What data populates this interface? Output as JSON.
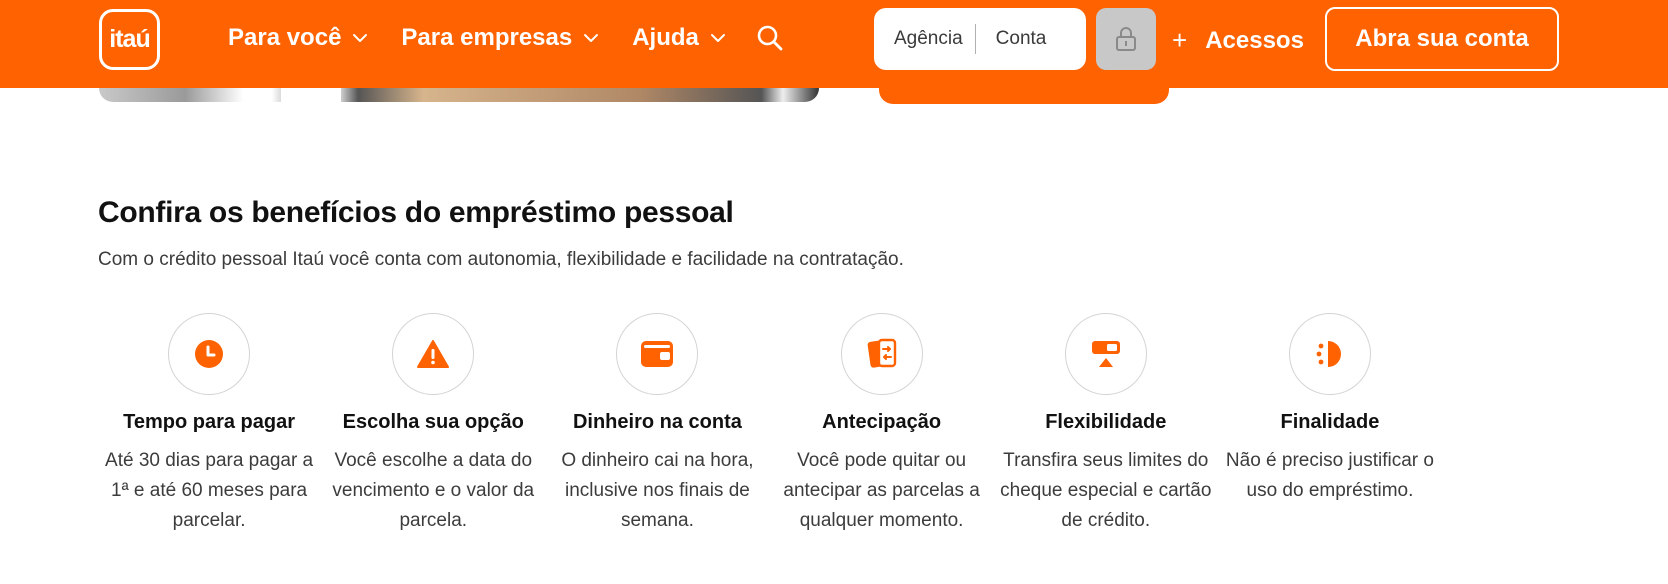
{
  "header": {
    "logo_text": "itaú",
    "nav": [
      {
        "label": "Para você"
      },
      {
        "label": "Para empresas"
      },
      {
        "label": "Ajuda"
      }
    ],
    "login": {
      "agencia_placeholder": "Agência",
      "conta_placeholder": "Conta"
    },
    "acessos_label": "Acessos",
    "abra_label": "Abra sua conta",
    "colors": {
      "brand": "#ff6200",
      "lock_bg": "#c8c8c8"
    }
  },
  "section": {
    "title": "Confira os benefícios do empréstimo pessoal",
    "subtitle": "Com o crédito pessoal Itaú você conta com autonomia, flexibilidade e facilidade na contratação."
  },
  "benefits": [
    {
      "icon": "clock-icon",
      "title": "Tempo para pagar",
      "text": "Até 30 dias para pagar a 1ª e até 60 meses para parcelar."
    },
    {
      "icon": "warning-icon",
      "title": "Escolha sua opção",
      "text": "Você escolhe a data do vencimento e o valor da parcela."
    },
    {
      "icon": "wallet-icon",
      "title": "Dinheiro na conta",
      "text": "O dinheiro cai na hora, inclusive nos finais de semana."
    },
    {
      "icon": "cards-exchange-icon",
      "title": "Antecipação",
      "text": "Você pode quitar ou antecipar as parcelas a qualquer momento."
    },
    {
      "icon": "toggle-icon",
      "title": "Flexibilidade",
      "text": "Transfira seus limites do cheque especial e cartão de crédito."
    },
    {
      "icon": "half-circle-icon",
      "title": "Finalidade",
      "text": "Não é preciso justificar o uso do empréstimo."
    }
  ]
}
